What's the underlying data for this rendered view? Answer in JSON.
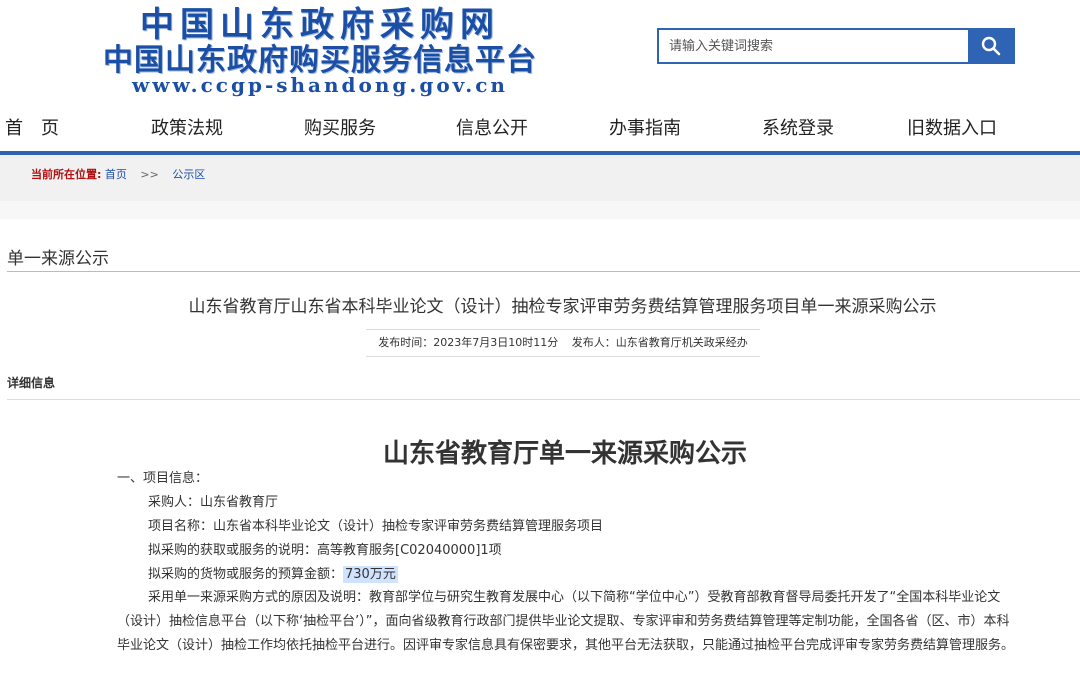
{
  "header": {
    "logo_line1": "中国山东政府采购网",
    "logo_line2": "中国山东政府购买服务信息平台",
    "logo_url": "www.ccgp-shandong.gov.cn",
    "search_placeholder": "请输入关键词搜索",
    "search_icon": "search-icon"
  },
  "nav": [
    "首　页",
    "政策法规",
    "购买服务",
    "信息公开",
    "办事指南",
    "系统登录",
    "旧数据入口"
  ],
  "breadcrumb": {
    "label": "当前所在位置:",
    "home": "首页",
    "sep": ">>",
    "current": "公示区"
  },
  "section_title": "单一来源公示",
  "article": {
    "title": "山东省教育厅山东省本科毕业论文（设计）抽检专家评审劳务费结算管理服务项目单一来源采购公示",
    "publish_time": "发布时间：2023年7月3日10时11分",
    "publisher": "发布人：山东省教育厅机关政采经办"
  },
  "detail_label": "详细信息",
  "doc": {
    "title": "山东省教育厅单一来源采购公示",
    "section1": "一、项目信息：",
    "purchaser": "采购人：山东省教育厅",
    "project_name": "项目名称：山东省本科毕业论文（设计）抽检专家评审劳务费结算管理服务项目",
    "service_desc": "拟采购的获取或服务的说明：高等教育服务[C02040000]1项",
    "budget_label": "拟采购的货物或服务的预算金额：",
    "budget_value": "730万元",
    "reason": "采用单一来源采购方式的原因及说明：教育部学位与研究生教育发展中心（以下简称“学位中心”）受教育部教育督导局委托开发了“全国本科毕业论文（设计）抽检信息平台（以下称‘抽检平台’）”，面向省级教育行政部门提供毕业论文提取、专家评审和劳务费结算管理等定制功能，全国各省（区、市）本科毕业论文（设计）抽检工作均依托抽检平台进行。因评审专家信息具有保密要求，其他平台无法获取，只能通过抽检平台完成评审专家劳务费结算管理服务。"
  },
  "colors": {
    "brand_blue": "#2f63b3",
    "breadcrumb_label": "#b01010",
    "highlight": "#cfe3ff"
  }
}
